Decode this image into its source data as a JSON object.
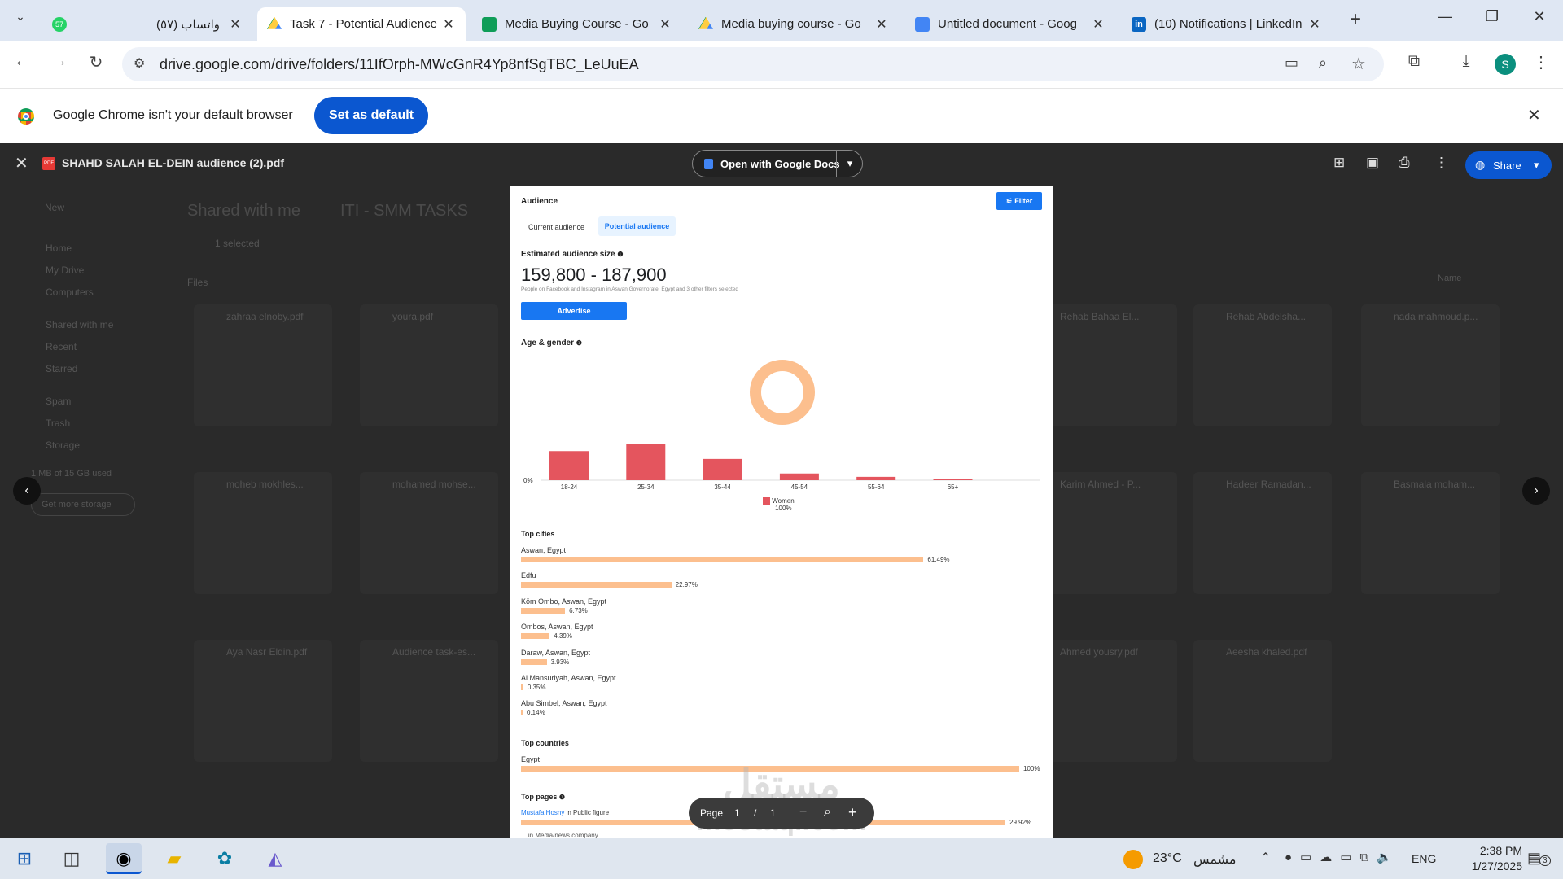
{
  "tabs": [
    {
      "title": "واتساب (٥٧)",
      "badge": "57",
      "active": false
    },
    {
      "title": "Task 7 - Potential Audience",
      "active": true
    },
    {
      "title": "Media Buying Course - Go",
      "active": false
    },
    {
      "title": "Media buying course - Go",
      "active": false
    },
    {
      "title": "Untitled document - Goog",
      "active": false
    },
    {
      "title": "(10) Notifications | LinkedIn",
      "active": false
    }
  ],
  "address": {
    "url": "drive.google.com/drive/folders/11IfOrph-MWcGnR4Yp8nfSgTBC_LeUuEA",
    "profile": "S"
  },
  "infobar": {
    "message": "Google Chrome isn't your default browser",
    "button": "Set as default"
  },
  "viewer": {
    "filename": "SHAHD SALAH EL-DEIN audience (2).pdf",
    "open_with": "Open with Google Docs",
    "share": "Share",
    "page_label": "Page",
    "page_current": "1",
    "page_sep": "/",
    "page_total": "1"
  },
  "background_drive": {
    "breadcrumb": [
      "Shared with me",
      "ITI - SMM TASKS"
    ],
    "new": "New",
    "selected": "1 selected",
    "files_label": "Files",
    "sort": "Name",
    "storage": "1 MB of 15 GB used",
    "get_storage": "Get more storage",
    "nav": [
      "Home",
      "My Drive",
      "Computers",
      "Shared with me",
      "Recent",
      "Starred",
      "Spam",
      "Trash",
      "Storage"
    ],
    "files": [
      "zahraa elnoby.pdf",
      "youra.pdf",
      "Rehab Bahaa El...",
      "Rehab Abdelsha...",
      "nada mahmoud.p...",
      "moheb mokhles...",
      "mohamed mohse...",
      "Karim Ahmed - P...",
      "Hadeer Ramadan...",
      "Basmala moham...",
      "Aya Nasr Eldin.pdf",
      "Audience task-es...",
      "Ahmed yousry.pdf",
      "Aeesha khaled.pdf"
    ]
  },
  "doc": {
    "title": "Audience",
    "filter": "Filter",
    "tab_current": "Current audience",
    "tab_potential": "Potential audience",
    "size_label": "Estimated audience size",
    "size_value": "159,800 - 187,900",
    "size_note": "People on Facebook and Instagram in Aswan Governorate, Egypt and 3 other filters selected",
    "advertise": "Advertise",
    "age_gender": "Age & gender",
    "zero": "0%",
    "legend_name": "Women",
    "legend_pct": "100%",
    "top_cities": "Top cities",
    "top_countries": "Top countries",
    "top_pages": "Top pages",
    "page1_name": "Mustafa Hosny",
    "page1_cat": " in Public figure",
    "page1_pct": "29.92%",
    "page2_partial": "... in Media/news company"
  },
  "chart_data": [
    {
      "type": "pie",
      "title": "Age & gender",
      "categories": [
        "Women"
      ],
      "values": [
        100
      ]
    },
    {
      "type": "bar",
      "categories": [
        "18-24",
        "25-34",
        "35-44",
        "45-54",
        "55-64",
        "65+"
      ],
      "series": [
        {
          "name": "Women",
          "values": [
            26,
            32,
            19,
            6,
            3,
            1
          ]
        }
      ]
    },
    {
      "type": "bar",
      "title": "Top cities",
      "categories": [
        "Aswan, Egypt",
        "Edfu",
        "Kōm Ombo, Aswan, Egypt",
        "Ombos, Aswan, Egypt",
        "Daraw, Aswan, Egypt",
        "Al Mansuriyah, Aswan, Egypt",
        "Abu Simbel, Aswan, Egypt"
      ],
      "values": [
        61.49,
        22.97,
        6.73,
        4.39,
        3.93,
        0.35,
        0.14
      ],
      "labels": [
        "61.49%",
        "22.97%",
        "6.73%",
        "4.39%",
        "3.93%",
        "0.35%",
        "0.14%"
      ]
    },
    {
      "type": "bar",
      "title": "Top countries",
      "categories": [
        "Egypt"
      ],
      "values": [
        100
      ],
      "labels": [
        "100%"
      ]
    }
  ],
  "watermark": {
    "arabic": "مستقل",
    "latin": "mostaql.com"
  },
  "taskbar": {
    "temp": "23°C",
    "weather": "مشمس",
    "lang": "ENG",
    "time": "2:38 PM",
    "date": "1/27/2025",
    "notif": "3"
  },
  "colors": {
    "chrome_blue": "#0b57d0",
    "bar_red": "#e4555e",
    "bar_peach": "#fcbf8e",
    "fb_blue": "#1877f2"
  }
}
